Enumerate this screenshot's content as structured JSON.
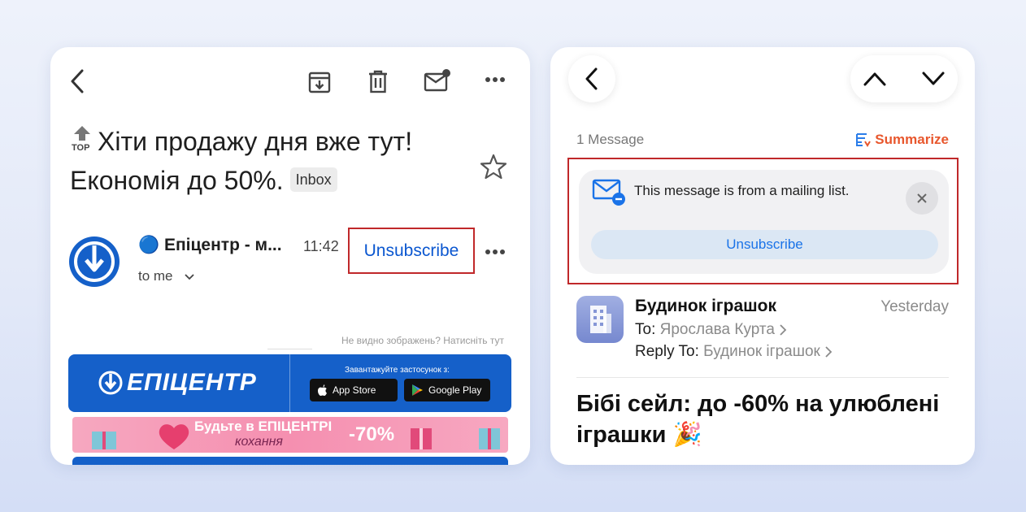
{
  "left": {
    "subject": "Хіти продажу дня вже тут! Економія до 50%.",
    "top_badge": "TOP",
    "inbox_label": "Inbox",
    "sender": "🔵 Епіцентр - м...",
    "time": "11:42",
    "unsubscribe": "Unsubscribe",
    "to": "to me",
    "images_note": "Не видно зображень? Натисніть тут",
    "banner": {
      "brand": "ЕПІЦЕНТР",
      "download_text": "Завантажуйте застосунок з:",
      "app_store": "App Store",
      "google_play": "Google Play"
    },
    "promo": {
      "line1": "Будьте в ЕПІЦЕНТРІ",
      "line2": "кохання",
      "percent": "-70%"
    }
  },
  "right": {
    "message_count": "1 Message",
    "summarize": "Summarize",
    "mailing_text": "This message is from a mailing list.",
    "unsubscribe": "Unsubscribe",
    "sender": "Будинок іграшок",
    "date": "Yesterday",
    "to_label": "To:",
    "to_value": "Ярослава Курта",
    "reply_label": "Reply To:",
    "reply_value": "Будинок іграшок",
    "subject": "Бібі сейл: до -60% на улюблені іграшки 🎉"
  },
  "colors": {
    "unsubscribe_blue": "#0b57d0",
    "highlight_red": "#c0282a",
    "brand_blue": "#1560c9"
  },
  "icons": [
    "back-icon",
    "archive-icon",
    "trash-icon",
    "mark-unread-icon",
    "more-icon",
    "star-icon",
    "chevron-down-icon",
    "chevron-up-icon",
    "summarize-icon",
    "mail-minus-icon",
    "close-icon",
    "building-icon",
    "chevron-right-icon"
  ]
}
